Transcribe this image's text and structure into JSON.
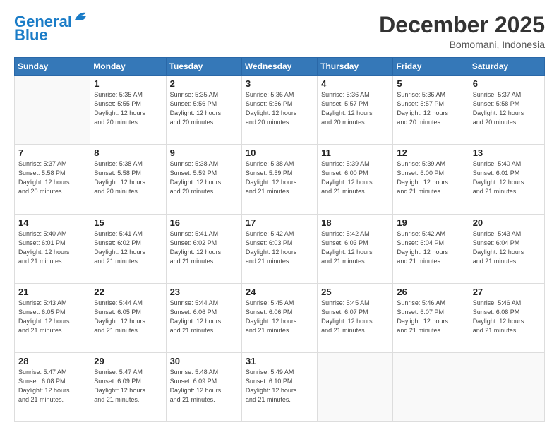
{
  "header": {
    "logo_line1": "General",
    "logo_line2": "Blue",
    "month": "December 2025",
    "location": "Bomomani, Indonesia"
  },
  "days_of_week": [
    "Sunday",
    "Monday",
    "Tuesday",
    "Wednesday",
    "Thursday",
    "Friday",
    "Saturday"
  ],
  "weeks": [
    [
      {
        "day": "",
        "info": ""
      },
      {
        "day": "1",
        "info": "Sunrise: 5:35 AM\nSunset: 5:55 PM\nDaylight: 12 hours\nand 20 minutes."
      },
      {
        "day": "2",
        "info": "Sunrise: 5:35 AM\nSunset: 5:56 PM\nDaylight: 12 hours\nand 20 minutes."
      },
      {
        "day": "3",
        "info": "Sunrise: 5:36 AM\nSunset: 5:56 PM\nDaylight: 12 hours\nand 20 minutes."
      },
      {
        "day": "4",
        "info": "Sunrise: 5:36 AM\nSunset: 5:57 PM\nDaylight: 12 hours\nand 20 minutes."
      },
      {
        "day": "5",
        "info": "Sunrise: 5:36 AM\nSunset: 5:57 PM\nDaylight: 12 hours\nand 20 minutes."
      },
      {
        "day": "6",
        "info": "Sunrise: 5:37 AM\nSunset: 5:58 PM\nDaylight: 12 hours\nand 20 minutes."
      }
    ],
    [
      {
        "day": "7",
        "info": "Sunrise: 5:37 AM\nSunset: 5:58 PM\nDaylight: 12 hours\nand 20 minutes."
      },
      {
        "day": "8",
        "info": "Sunrise: 5:38 AM\nSunset: 5:58 PM\nDaylight: 12 hours\nand 20 minutes."
      },
      {
        "day": "9",
        "info": "Sunrise: 5:38 AM\nSunset: 5:59 PM\nDaylight: 12 hours\nand 20 minutes."
      },
      {
        "day": "10",
        "info": "Sunrise: 5:38 AM\nSunset: 5:59 PM\nDaylight: 12 hours\nand 21 minutes."
      },
      {
        "day": "11",
        "info": "Sunrise: 5:39 AM\nSunset: 6:00 PM\nDaylight: 12 hours\nand 21 minutes."
      },
      {
        "day": "12",
        "info": "Sunrise: 5:39 AM\nSunset: 6:00 PM\nDaylight: 12 hours\nand 21 minutes."
      },
      {
        "day": "13",
        "info": "Sunrise: 5:40 AM\nSunset: 6:01 PM\nDaylight: 12 hours\nand 21 minutes."
      }
    ],
    [
      {
        "day": "14",
        "info": "Sunrise: 5:40 AM\nSunset: 6:01 PM\nDaylight: 12 hours\nand 21 minutes."
      },
      {
        "day": "15",
        "info": "Sunrise: 5:41 AM\nSunset: 6:02 PM\nDaylight: 12 hours\nand 21 minutes."
      },
      {
        "day": "16",
        "info": "Sunrise: 5:41 AM\nSunset: 6:02 PM\nDaylight: 12 hours\nand 21 minutes."
      },
      {
        "day": "17",
        "info": "Sunrise: 5:42 AM\nSunset: 6:03 PM\nDaylight: 12 hours\nand 21 minutes."
      },
      {
        "day": "18",
        "info": "Sunrise: 5:42 AM\nSunset: 6:03 PM\nDaylight: 12 hours\nand 21 minutes."
      },
      {
        "day": "19",
        "info": "Sunrise: 5:42 AM\nSunset: 6:04 PM\nDaylight: 12 hours\nand 21 minutes."
      },
      {
        "day": "20",
        "info": "Sunrise: 5:43 AM\nSunset: 6:04 PM\nDaylight: 12 hours\nand 21 minutes."
      }
    ],
    [
      {
        "day": "21",
        "info": "Sunrise: 5:43 AM\nSunset: 6:05 PM\nDaylight: 12 hours\nand 21 minutes."
      },
      {
        "day": "22",
        "info": "Sunrise: 5:44 AM\nSunset: 6:05 PM\nDaylight: 12 hours\nand 21 minutes."
      },
      {
        "day": "23",
        "info": "Sunrise: 5:44 AM\nSunset: 6:06 PM\nDaylight: 12 hours\nand 21 minutes."
      },
      {
        "day": "24",
        "info": "Sunrise: 5:45 AM\nSunset: 6:06 PM\nDaylight: 12 hours\nand 21 minutes."
      },
      {
        "day": "25",
        "info": "Sunrise: 5:45 AM\nSunset: 6:07 PM\nDaylight: 12 hours\nand 21 minutes."
      },
      {
        "day": "26",
        "info": "Sunrise: 5:46 AM\nSunset: 6:07 PM\nDaylight: 12 hours\nand 21 minutes."
      },
      {
        "day": "27",
        "info": "Sunrise: 5:46 AM\nSunset: 6:08 PM\nDaylight: 12 hours\nand 21 minutes."
      }
    ],
    [
      {
        "day": "28",
        "info": "Sunrise: 5:47 AM\nSunset: 6:08 PM\nDaylight: 12 hours\nand 21 minutes."
      },
      {
        "day": "29",
        "info": "Sunrise: 5:47 AM\nSunset: 6:09 PM\nDaylight: 12 hours\nand 21 minutes."
      },
      {
        "day": "30",
        "info": "Sunrise: 5:48 AM\nSunset: 6:09 PM\nDaylight: 12 hours\nand 21 minutes."
      },
      {
        "day": "31",
        "info": "Sunrise: 5:49 AM\nSunset: 6:10 PM\nDaylight: 12 hours\nand 21 minutes."
      },
      {
        "day": "",
        "info": ""
      },
      {
        "day": "",
        "info": ""
      },
      {
        "day": "",
        "info": ""
      }
    ]
  ]
}
